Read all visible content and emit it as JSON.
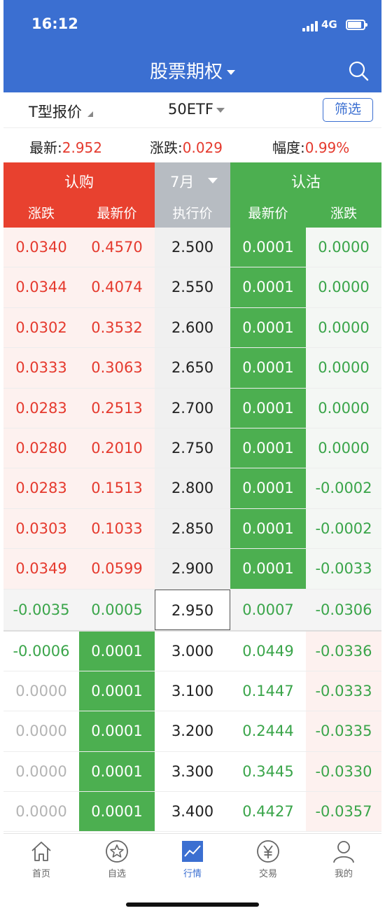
{
  "status": {
    "time": "16:12",
    "network": "4G"
  },
  "nav": {
    "title": "股票期权"
  },
  "toolbar": {
    "mode": "T型报价",
    "underlying": "50ETF",
    "filter": "筛选"
  },
  "quote": {
    "latest_label": "最新:",
    "latest_value": "2.952",
    "change_label": "涨跌:",
    "change_value": "0.029",
    "pct_label": "幅度:",
    "pct_value": "0.99%"
  },
  "header": {
    "call_title": "认购",
    "put_title": "认沽",
    "month": "7月",
    "col_change": "涨跌",
    "col_price": "最新价",
    "col_strike": "执行价",
    "col_put_price": "最新价",
    "col_put_change": "涨跌"
  },
  "rows_upper": [
    {
      "call_change": "0.0340",
      "call_price": "0.4570",
      "strike": "2.500",
      "put_price": "0.0001",
      "put_change": "0.0000"
    },
    {
      "call_change": "0.0344",
      "call_price": "0.4074",
      "strike": "2.550",
      "put_price": "0.0001",
      "put_change": "0.0000"
    },
    {
      "call_change": "0.0302",
      "call_price": "0.3532",
      "strike": "2.600",
      "put_price": "0.0001",
      "put_change": "0.0000"
    },
    {
      "call_change": "0.0333",
      "call_price": "0.3063",
      "strike": "2.650",
      "put_price": "0.0001",
      "put_change": "0.0000"
    },
    {
      "call_change": "0.0283",
      "call_price": "0.2513",
      "strike": "2.700",
      "put_price": "0.0001",
      "put_change": "0.0000"
    },
    {
      "call_change": "0.0280",
      "call_price": "0.2010",
      "strike": "2.750",
      "put_price": "0.0001",
      "put_change": "0.0000"
    },
    {
      "call_change": "0.0283",
      "call_price": "0.1513",
      "strike": "2.800",
      "put_price": "0.0001",
      "put_change": "-0.0002"
    },
    {
      "call_change": "0.0303",
      "call_price": "0.1033",
      "strike": "2.850",
      "put_price": "0.0001",
      "put_change": "-0.0002"
    },
    {
      "call_change": "0.0349",
      "call_price": "0.0599",
      "strike": "2.900",
      "put_price": "0.0001",
      "put_change": "-0.0033"
    }
  ],
  "row_atm": {
    "call_change": "-0.0035",
    "call_price": "0.0005",
    "strike": "2.950",
    "put_price": "0.0007",
    "put_change": "-0.0306"
  },
  "rows_lower": [
    {
      "call_change": "-0.0006",
      "call_price": "0.0001",
      "strike": "3.000",
      "put_price": "0.0449",
      "put_change": "-0.0336"
    },
    {
      "call_change": "0.0000",
      "call_price": "0.0001",
      "strike": "3.100",
      "put_price": "0.1447",
      "put_change": "-0.0333"
    },
    {
      "call_change": "0.0000",
      "call_price": "0.0001",
      "strike": "3.200",
      "put_price": "0.2444",
      "put_change": "-0.0335"
    },
    {
      "call_change": "0.0000",
      "call_price": "0.0001",
      "strike": "3.300",
      "put_price": "0.3445",
      "put_change": "-0.0330"
    },
    {
      "call_change": "0.0000",
      "call_price": "0.0001",
      "strike": "3.400",
      "put_price": "0.4427",
      "put_change": "-0.0357"
    }
  ],
  "tabs": [
    {
      "label": "首页",
      "icon": "home-icon"
    },
    {
      "label": "自选",
      "icon": "star-icon"
    },
    {
      "label": "行情",
      "icon": "chart-icon"
    },
    {
      "label": "交易",
      "icon": "yen-icon"
    },
    {
      "label": "我的",
      "icon": "user-icon"
    }
  ],
  "colors": {
    "brand": "#3b6fd1",
    "up": "#e53a2e",
    "down": "#3aa54a",
    "call_header": "#e8412f",
    "put_header": "#4caf50"
  }
}
